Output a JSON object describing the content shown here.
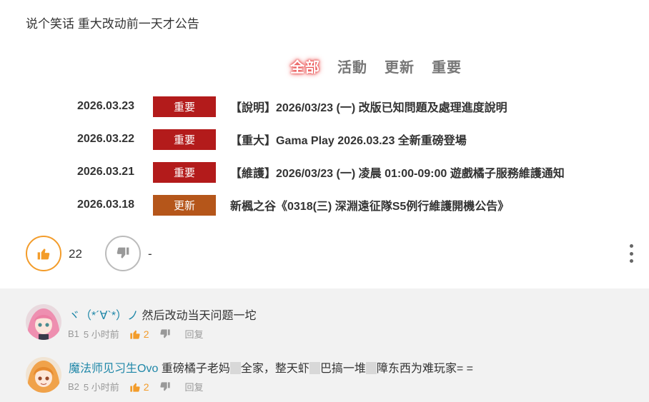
{
  "post": {
    "text": "说个笑话 重大改动前一天才公告"
  },
  "tabs": [
    {
      "label": "全部",
      "active": true
    },
    {
      "label": "活動",
      "active": false
    },
    {
      "label": "更新",
      "active": false
    },
    {
      "label": "重要",
      "active": false
    }
  ],
  "news": [
    {
      "date": "2026.03.23",
      "badge": "重要",
      "badge_color": "#b31b1b",
      "title": "【說明】2026/03/23 (一) 改版已知問題及處理進度說明"
    },
    {
      "date": "2026.03.22",
      "badge": "重要",
      "badge_color": "#b31b1b",
      "title": "【重大】Gama Play 2026.03.23 全新重磅登場"
    },
    {
      "date": "2026.03.21",
      "badge": "重要",
      "badge_color": "#b31b1b",
      "title": "【維護】2026/03/23 (一) 凌晨 01:00-09:00 遊戲橘子服務維護通知"
    },
    {
      "date": "2026.03.18",
      "badge": "更新",
      "badge_color": "#b5561a",
      "title": "新楓之谷《0318(三) 深淵遠征隊S5例行維護開機公告》"
    }
  ],
  "actions": {
    "like_count": "22",
    "dislike_count": "-"
  },
  "comments": [
    {
      "author": "ヾ（*´∀`*）ノ",
      "text_parts": [
        "然后改动当天问题一坨"
      ],
      "floor": "B1",
      "time": "5 小时前",
      "likes": "2",
      "reply_label": "回复"
    },
    {
      "author": "魔法师见习生Ovo",
      "text_parts": [
        "重磅橘子老妈",
        "全家，整天虾",
        "巴搞一堆",
        "障东西为难玩家= ="
      ],
      "floor": "B2",
      "time": "5 小时前",
      "likes": "2",
      "reply_label": "回复"
    }
  ],
  "colors": {
    "accent": "#f39c2a",
    "author": "#1f87a8",
    "important": "#b31b1b",
    "update": "#b5561a"
  },
  "icons": {
    "like": "thumbs-up-icon",
    "dislike": "thumbs-down-icon",
    "more": "more-vertical-icon"
  }
}
